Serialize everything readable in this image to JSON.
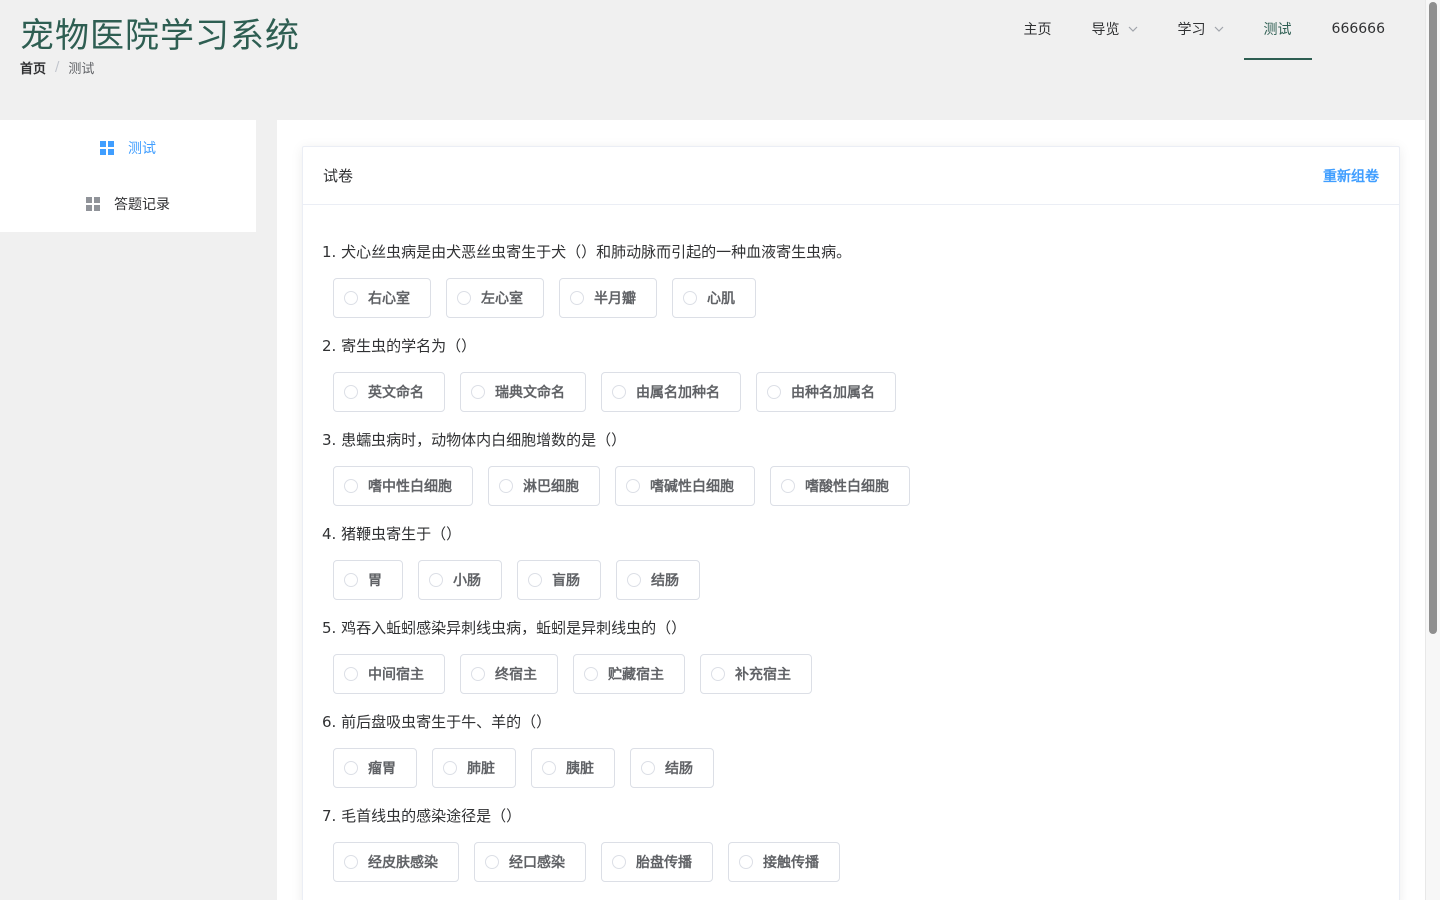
{
  "header": {
    "title": "宠物医院学习系统",
    "breadcrumb": {
      "home": "首页",
      "separator": "/",
      "current": "测试"
    }
  },
  "nav": {
    "items": [
      {
        "label": "主页"
      },
      {
        "label": "导览"
      },
      {
        "label": "学习"
      },
      {
        "label": "测试"
      },
      {
        "label": "666666"
      }
    ]
  },
  "sidebar": {
    "items": [
      {
        "label": "测试"
      },
      {
        "label": "答题记录"
      }
    ]
  },
  "card": {
    "title": "试卷",
    "regen_label": "重新组卷"
  },
  "questions": [
    {
      "text": "1. 犬心丝虫病是由犬恶丝虫寄生于犬（）和肺动脉而引起的一种血液寄生虫病。",
      "options": [
        "右心室",
        "左心室",
        "半月瓣",
        "心肌"
      ]
    },
    {
      "text": "2. 寄生虫的学名为（）",
      "options": [
        "英文命名",
        "瑞典文命名",
        "由属名加种名",
        "由种名加属名"
      ]
    },
    {
      "text": "3. 患蠕虫病时，动物体内白细胞增数的是（）",
      "options": [
        "嗜中性白细胞",
        "淋巴细胞",
        "嗜碱性白细胞",
        "嗜酸性白细胞"
      ]
    },
    {
      "text": "4. 猪鞭虫寄生于（）",
      "options": [
        "胃",
        "小肠",
        "盲肠",
        "结肠"
      ]
    },
    {
      "text": "5. 鸡吞入蚯蚓感染异刺线虫病，蚯蚓是异刺线虫的（）",
      "options": [
        "中间宿主",
        "终宿主",
        "贮藏宿主",
        "补充宿主"
      ]
    },
    {
      "text": "6. 前后盘吸虫寄生于牛、羊的（）",
      "options": [
        "瘤胃",
        "肺脏",
        "胰脏",
        "结肠"
      ]
    },
    {
      "text": "7. 毛首线虫的感染途径是（）",
      "options": [
        "经皮肤感染",
        "经口感染",
        "胎盘传播",
        "接触传播"
      ]
    }
  ],
  "colors": {
    "brand": "#2e5e52",
    "accent": "#409eff",
    "background": "#f0f0f0"
  }
}
